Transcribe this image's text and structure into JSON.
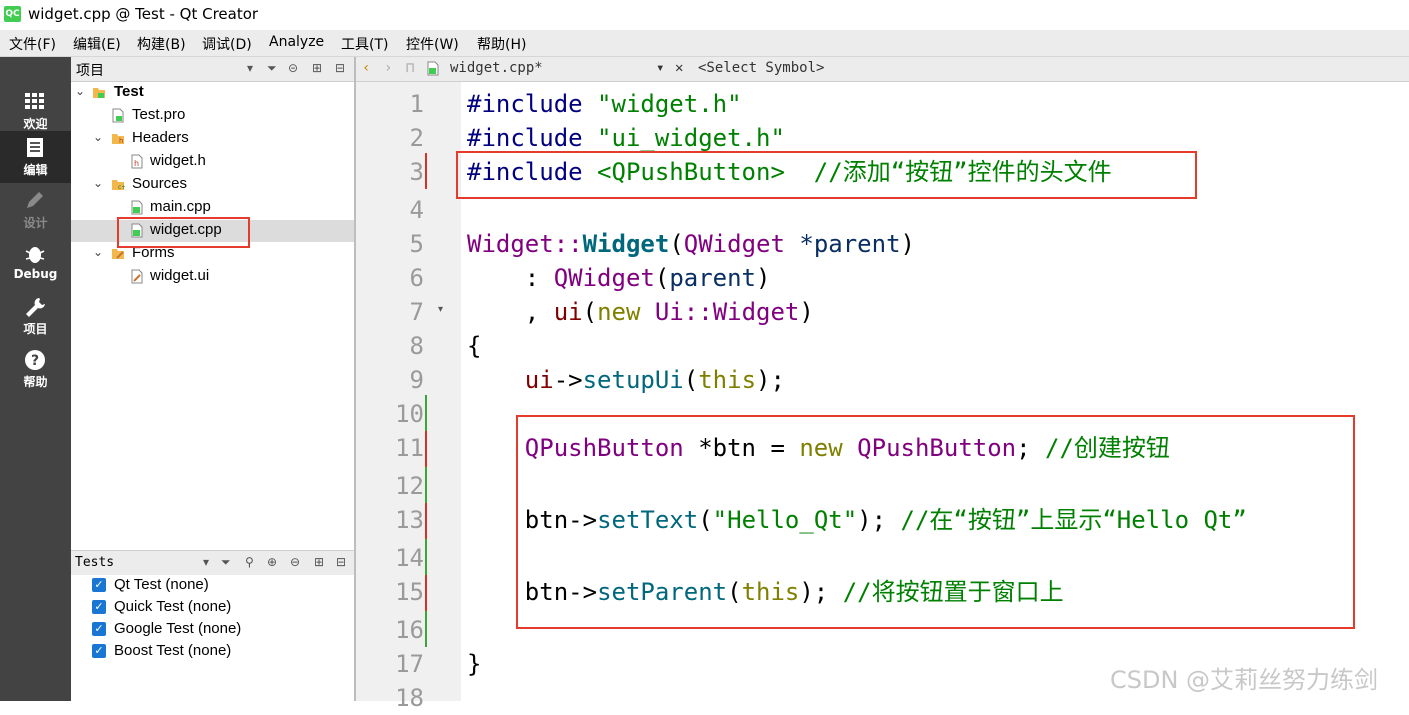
{
  "window": {
    "title": "widget.cpp @ Test - Qt Creator",
    "logo_text": "QC"
  },
  "menu": [
    "文件(F)",
    "编辑(E)",
    "构建(B)",
    "调试(D)",
    "Analyze",
    "工具(T)",
    "控件(W)",
    "帮助(H)"
  ],
  "modes": [
    {
      "label": "欢迎",
      "icon": "grid-icon"
    },
    {
      "label": "编辑",
      "icon": "edit-document-icon",
      "active": true
    },
    {
      "label": "设计",
      "icon": "pencil-icon",
      "disabled": true
    },
    {
      "label": "Debug",
      "icon": "bug-icon"
    },
    {
      "label": "项目",
      "icon": "wrench-icon"
    },
    {
      "label": "帮助",
      "icon": "help-icon"
    }
  ],
  "project_panel": {
    "title": "项目",
    "tree": [
      {
        "label": "Test",
        "icon": "project-folder-icon",
        "expanded": true,
        "bold": true
      },
      {
        "label": "Test.pro",
        "icon": "pro-file-icon"
      },
      {
        "label": "Headers",
        "icon": "folder-icon",
        "expanded": true
      },
      {
        "label": "widget.h",
        "icon": "header-file-icon"
      },
      {
        "label": "Sources",
        "icon": "folder-icon",
        "expanded": true
      },
      {
        "label": "main.cpp",
        "icon": "cpp-file-icon"
      },
      {
        "label": "widget.cpp",
        "icon": "cpp-file-icon",
        "selected": true
      },
      {
        "label": "Forms",
        "icon": "folder-icon",
        "expanded": true
      },
      {
        "label": "widget.ui",
        "icon": "ui-file-icon"
      }
    ]
  },
  "tests_panel": {
    "title": "Tests",
    "items": [
      "Qt Test (none)",
      "Quick Test (none)",
      "Google Test (none)",
      "Boost Test (none)"
    ]
  },
  "editor": {
    "file_tab": "widget.cpp*",
    "symbol_selector": "<Select Symbol>",
    "line_numbers": [
      "1",
      "2",
      "3",
      "4",
      "5",
      "6",
      "7",
      "8",
      "9",
      "10",
      "11",
      "12",
      "13",
      "14",
      "15",
      "16",
      "17",
      "18"
    ],
    "code": {
      "l1": {
        "directive": "#include",
        "arg": "\"widget.h\""
      },
      "l2": {
        "directive": "#include",
        "arg": "\"ui_widget.h\""
      },
      "l3": {
        "directive": "#include",
        "arg": "<QPushButton>",
        "comment": "//添加“按钮”控件的头文件"
      },
      "l5": {
        "cls": "Widget",
        "sep": "::",
        "fn": "Widget",
        "open": "(",
        "ptype": "QWidget",
        "pname": " *parent",
        "close": ")"
      },
      "l6": {
        "lead": "    : ",
        "base": "QWidget",
        "open": "(",
        "arg": "parent",
        "close": ")"
      },
      "l7": {
        "lead": "    , ",
        "member": "ui",
        "open": "(",
        "kw": "new",
        "ns": "Ui",
        "sep": "::",
        "cls": "Widget",
        "close": ")"
      },
      "l8": "{",
      "l9": {
        "lead": "    ",
        "obj": "ui",
        "arrow": "->",
        "fn": "setupUi",
        "open": "(",
        "kw": "this",
        "close": ");"
      },
      "l11": {
        "lead": "    ",
        "cls": "QPushButton",
        "var": " *btn",
        "eq": " = ",
        "kw": "new",
        "cls2": "QPushButton",
        "semi": ";",
        "comment": "//创建按钮"
      },
      "l13": {
        "lead": "    ",
        "obj": "btn",
        "arrow": "->",
        "fn": "setText",
        "open": "(",
        "str": "\"Hello_Qt\"",
        "close": ");",
        "comment": "//在“按钮”上显示“Hello Qt”"
      },
      "l15": {
        "lead": "    ",
        "obj": "btn",
        "arrow": "->",
        "fn": "setParent",
        "open": "(",
        "kw": "this",
        "close": ");",
        "comment": "//将按钮置于窗口上"
      },
      "l17": "}"
    }
  },
  "watermark": "CSDN @艾莉丝努力练剑",
  "colors": {
    "highlight_border": "#e53b2c",
    "modebar_bg": "#434343",
    "checkbox": "#1976d2"
  }
}
